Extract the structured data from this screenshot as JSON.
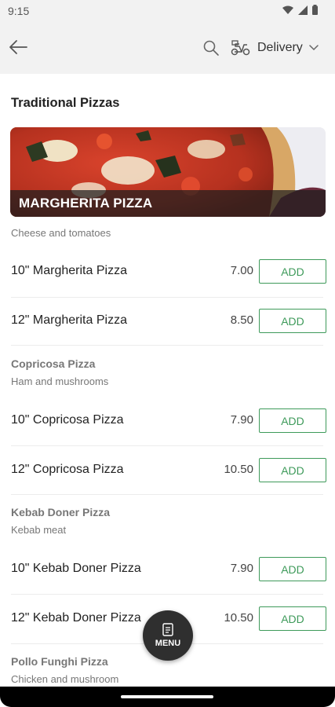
{
  "status": {
    "time": "9:15"
  },
  "app_bar": {
    "back_icon": "arrow-left-icon",
    "search_icon": "search-icon",
    "delivery_icon": "scooter-icon",
    "delivery_label": "Delivery",
    "chevron_icon": "chevron-down-icon"
  },
  "section": {
    "title": "Traditional Pizzas",
    "hero_title": "MARGHERITA PIZZA",
    "hero_desc": "Cheese and tomatoes"
  },
  "groups": [
    {
      "name": "",
      "desc": "",
      "items": [
        {
          "name": "10\" Margherita Pizza",
          "price": "7.00",
          "add_label": "ADD"
        },
        {
          "name": "12\" Margherita Pizza",
          "price": "8.50",
          "add_label": "ADD"
        }
      ]
    },
    {
      "name": "Copricosa Pizza",
      "desc": "Ham and mushrooms",
      "items": [
        {
          "name": "10\" Copricosa Pizza",
          "price": "7.90",
          "add_label": "ADD"
        },
        {
          "name": "12\" Copricosa Pizza",
          "price": "10.50",
          "add_label": "ADD"
        }
      ]
    },
    {
      "name": "Kebab Doner Pizza",
      "desc": "Kebab meat",
      "items": [
        {
          "name": "10\" Kebab Doner Pizza",
          "price": "7.90",
          "add_label": "ADD"
        },
        {
          "name": "12\" Kebab Doner Pizza",
          "price": "10.50",
          "add_label": "ADD"
        }
      ]
    },
    {
      "name": "Pollo Funghi Pizza",
      "desc": "Chicken and mushroom",
      "items": []
    }
  ],
  "fab": {
    "label": "MENU",
    "icon": "menu-document-icon"
  },
  "colors": {
    "accent": "#3e9a5a",
    "app_bar_bg": "#f2f2f2",
    "fab_bg": "#2f2f2f"
  }
}
